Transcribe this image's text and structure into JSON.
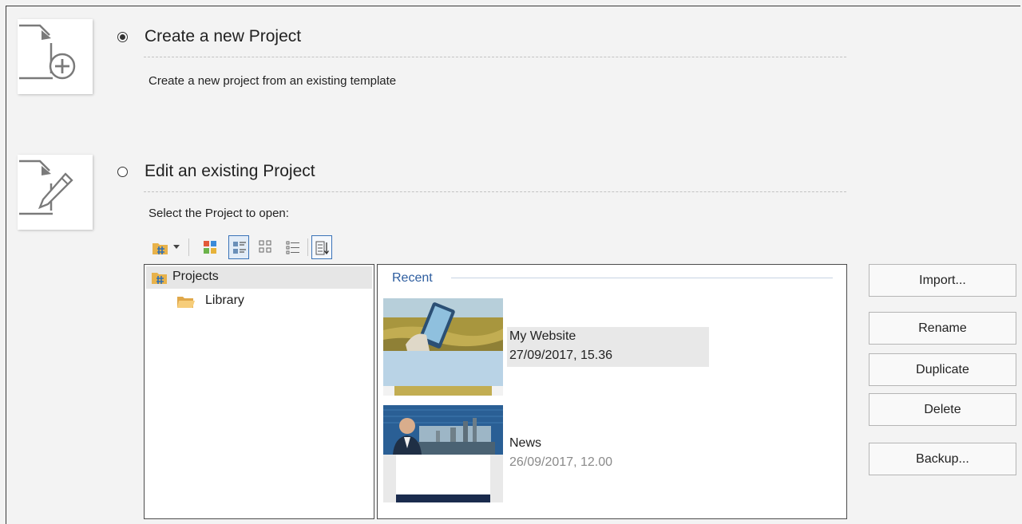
{
  "create_option": {
    "title": "Create a new Project",
    "description": "Create a new project from an existing template",
    "selected": true
  },
  "edit_option": {
    "title": "Edit an existing Project",
    "select_label": "Select the Project to open:",
    "selected": false
  },
  "toolbar": {
    "icons": [
      "project-folder-icon",
      "dropdown-arrow-icon",
      "large-icons-view-icon",
      "tiles-view-icon",
      "medium-icons-view-icon",
      "list-view-icon",
      "sort-icon"
    ],
    "active_view": "tiles"
  },
  "tree": {
    "items": [
      {
        "label": "Projects",
        "icon": "project-folder-icon",
        "selected": true
      },
      {
        "label": "Library",
        "icon": "folder-icon",
        "selected": false
      }
    ]
  },
  "recent": {
    "title": "Recent",
    "projects": [
      {
        "name": "My Website",
        "date": "27/09/2017, 15.36",
        "selected": true,
        "date_color": "#222222"
      },
      {
        "name": "News",
        "date": "26/09/2017, 12.00",
        "selected": false,
        "date_color": "#8a8a8a"
      }
    ]
  },
  "buttons": {
    "import": "Import...",
    "rename": "Rename",
    "duplicate": "Duplicate",
    "delete": "Delete",
    "backup": "Backup..."
  },
  "colors": {
    "background": "#f3f3f3",
    "accent": "#2d5d9f",
    "folder": "#f2c46b"
  }
}
